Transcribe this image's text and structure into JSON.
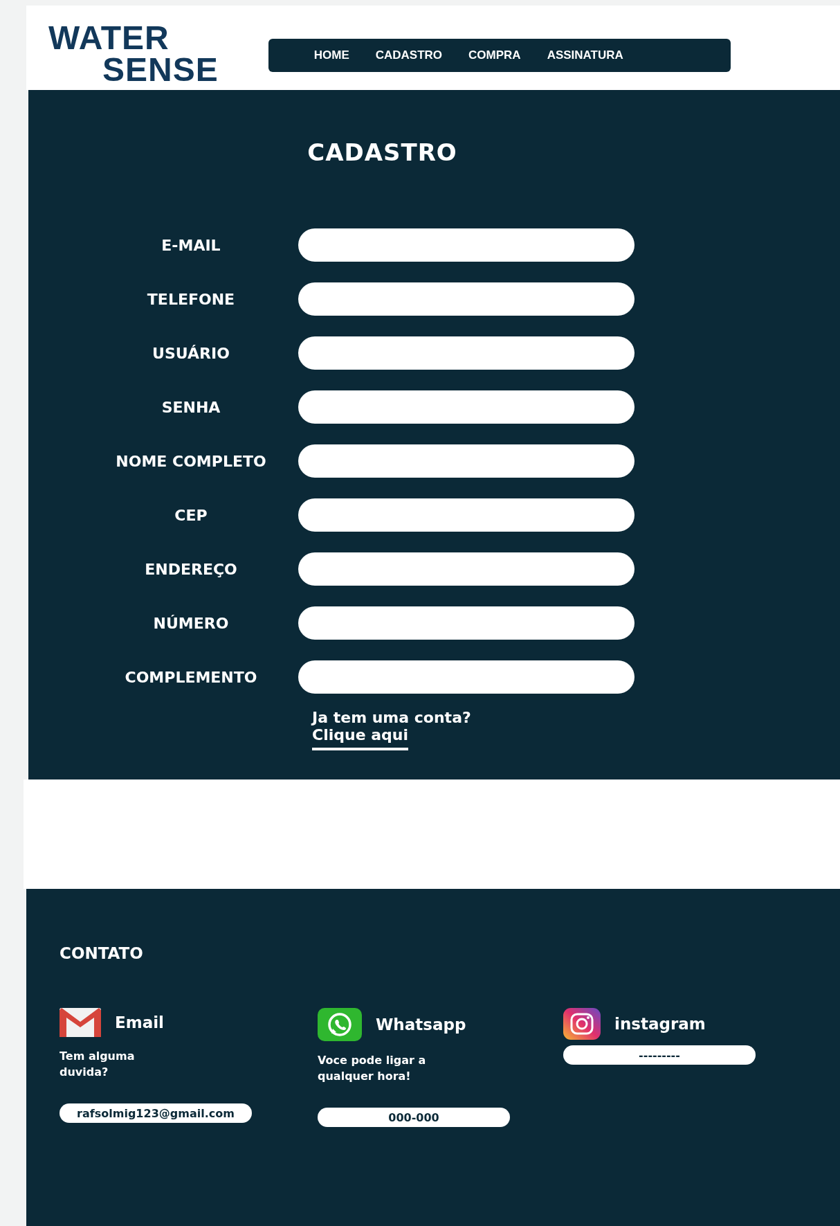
{
  "logo": {
    "line_1": "WATER",
    "line_2": "SENSE"
  },
  "nav": [
    {
      "label": "HOME"
    },
    {
      "label": "CADASTRO"
    },
    {
      "label": "COMPRA"
    },
    {
      "label": "ASSINATURA"
    }
  ],
  "form": {
    "title": "CADASTRO",
    "fields": [
      {
        "label": "E-MAIL"
      },
      {
        "label": "TELEFONE"
      },
      {
        "label": "USUÁRIO"
      },
      {
        "label": "SENHA"
      },
      {
        "label": "NOME COMPLETO"
      },
      {
        "label": "CEP"
      },
      {
        "label": "ENDEREÇO"
      },
      {
        "label": "NÚMERO"
      },
      {
        "label": "COMPLEMENTO"
      }
    ],
    "login_prompt": "Ja tem uma conta?",
    "login_link": "Clique aqui"
  },
  "footer": {
    "heading": "CONTATO",
    "contacts": [
      {
        "kind": "email",
        "name": "Email",
        "note": "Tem alguma duvida?",
        "value": "rafsolmig123@gmail.com"
      },
      {
        "kind": "whatsapp",
        "name": "Whatsapp",
        "note": "Voce pode ligar a qualquer hora!",
        "value": "000-000"
      },
      {
        "kind": "instagram",
        "name": "instagram",
        "value": "---------"
      }
    ]
  }
}
